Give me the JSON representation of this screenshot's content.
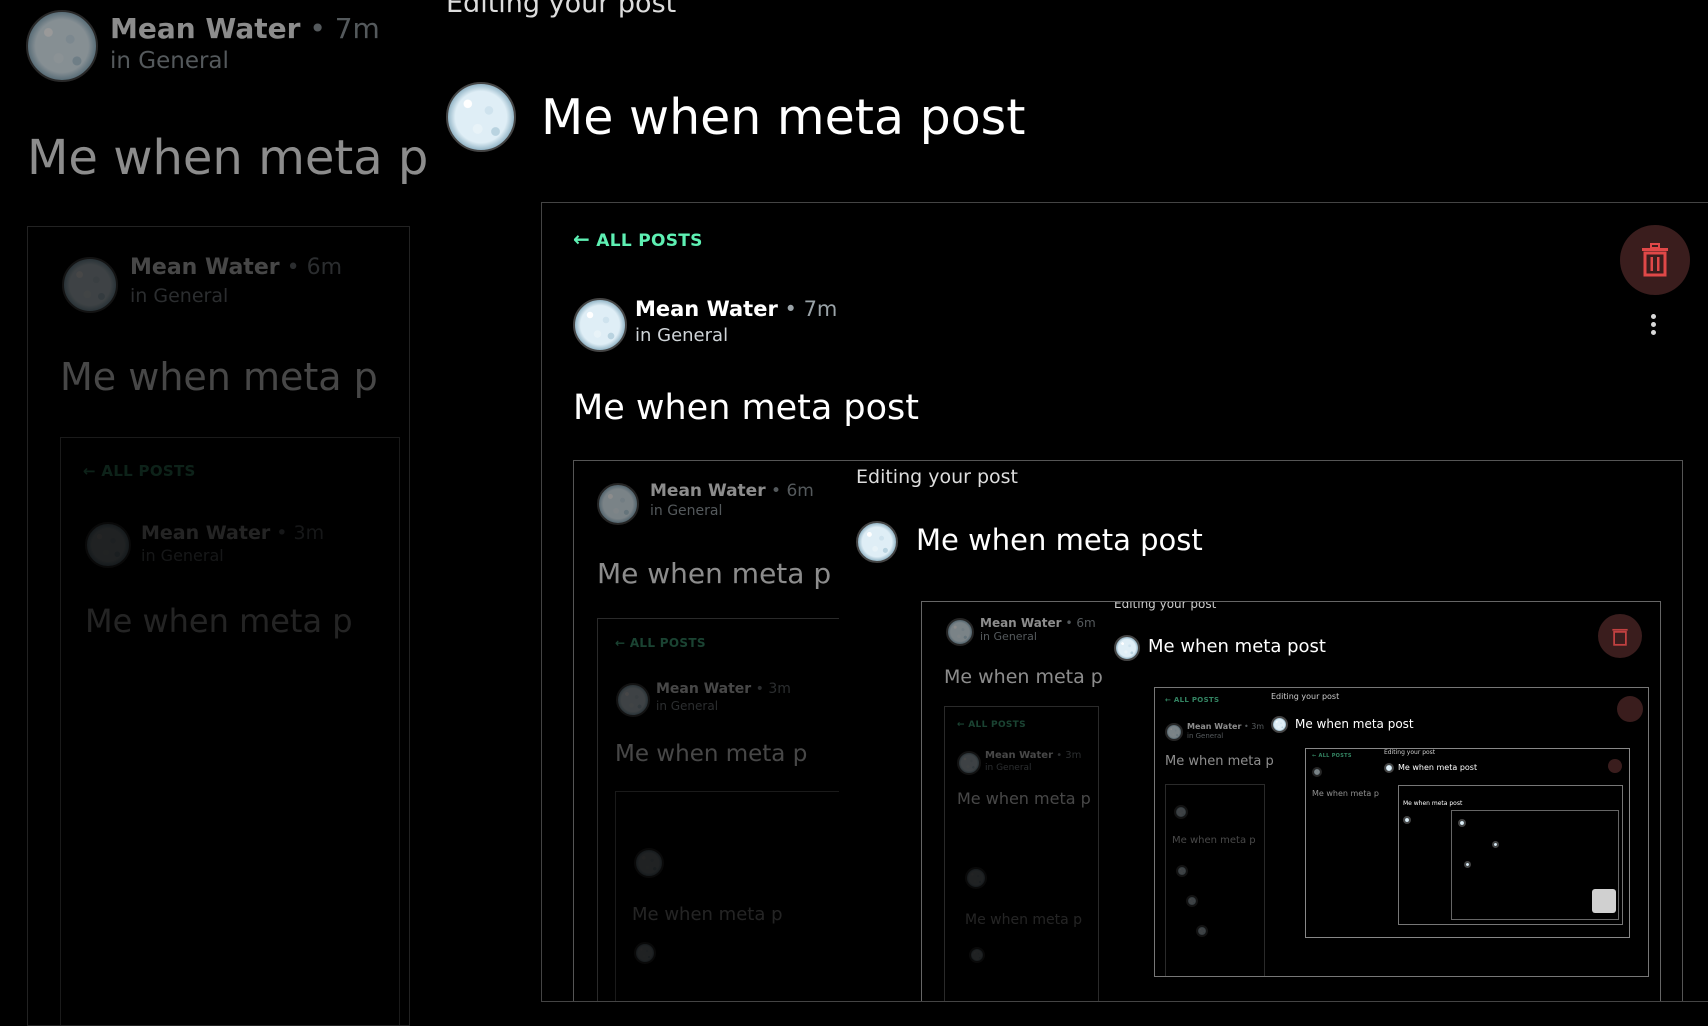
{
  "left_panel": {
    "author": "Mean Water",
    "time": "7m",
    "channel": "in General",
    "title": "Me when meta p",
    "nested": {
      "author": "Mean Water",
      "time": "6m",
      "channel": "in General",
      "title": "Me when meta p",
      "all_posts": "ALL POSTS",
      "inner": {
        "author": "Mean Water",
        "time": "3m",
        "channel": "in General",
        "title": "Me when meta p"
      }
    }
  },
  "editor": {
    "heading": "Editing your post",
    "title": "Me when meta post"
  },
  "post_card": {
    "back_label": "ALL POSTS",
    "author": "Mean Water",
    "separator": "•",
    "time": "7m",
    "channel": "in General",
    "title": "Me when meta post",
    "embed": {
      "left": {
        "author": "Mean Water",
        "time": "6m",
        "channel": "in General",
        "title": "Me when meta p",
        "all_posts": "ALL POSTS",
        "inner_author": "Mean Water",
        "inner_time": "3m",
        "inner_channel": "in General",
        "inner_title": "Me when meta p"
      },
      "editor_heading": "Editing your post",
      "editor_title": "Me when meta post",
      "level3": {
        "author": "Mean Water",
        "time": "6m",
        "channel": "in General",
        "title": "Me when meta p",
        "all_posts": "ALL POSTS",
        "inner_author": "Mean Water",
        "inner_time": "3m",
        "inner_channel": "in General",
        "inner_title": "Me when meta p",
        "editor_heading": "Editing your post",
        "editor_title": "Me when meta post",
        "level4": {
          "all_posts": "ALL POSTS",
          "author": "Mean Water",
          "time": "3m",
          "channel": "in General",
          "title": "Me when meta p",
          "editor_heading": "Editing your post",
          "editor_title": "Me when meta post",
          "level5_title": "Me when meta post",
          "level5_heading": "Editing your post"
        }
      }
    }
  }
}
